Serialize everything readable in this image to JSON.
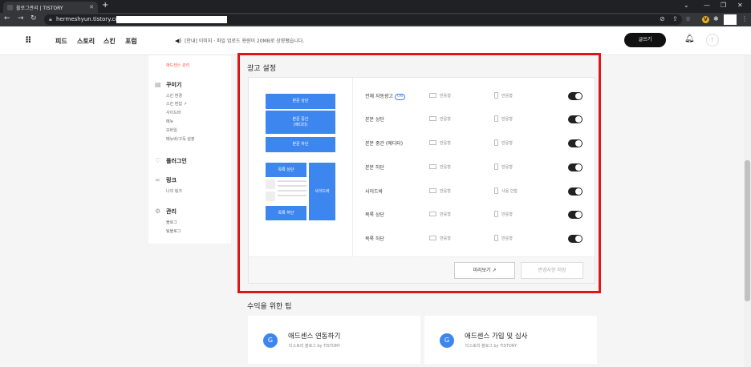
{
  "browser": {
    "tab_title": "블로그관리 | TISTORY",
    "url": "hermeshyun.tistory.com"
  },
  "header": {
    "logo": "⠿",
    "nav": [
      "피드",
      "스토리",
      "스킨",
      "포럼"
    ],
    "notice": "[안내] 이미지 · 파일 업로드 용량이 20MB로 상향됐습니다.",
    "write_button": "글쓰기",
    "avatar_initial": "T"
  },
  "sidebar": {
    "active_item": "애드센스 관리",
    "sections": [
      {
        "icon": "layout-icon",
        "title": "꾸미기",
        "items": [
          "스킨 변경",
          "스킨 편집 ↗",
          "사이드바",
          "메뉴",
          "모바일",
          "메뉴바/구독 설정"
        ]
      },
      {
        "icon": "plugin-icon",
        "title": "플러그인",
        "items": []
      },
      {
        "icon": "link-icon",
        "title": "링크",
        "items": [
          "나의 링크"
        ]
      },
      {
        "icon": "settings-icon",
        "title": "관리",
        "items": [
          "블로그",
          "팀블로그"
        ]
      }
    ]
  },
  "ad_settings": {
    "title": "광고 설정",
    "preview": {
      "body_top": "본문 상단",
      "body_middle_line1": "본문 중간",
      "body_middle_line2": "(에디터)",
      "body_bottom": "본문 하단",
      "list_top": "목록 상단",
      "list_bottom": "목록 하단",
      "sidebar": "사이드바"
    },
    "rows": [
      {
        "label": "전체 자동광고",
        "badge": "ON",
        "pc": "반응형",
        "mobile": "반응형",
        "enabled": true
      },
      {
        "label": "본문 상단",
        "pc": "반응형",
        "mobile": "반응형",
        "enabled": true
      },
      {
        "label": "본문 중간 (에디터)",
        "pc": "반응형",
        "mobile": "반응형",
        "enabled": true
      },
      {
        "label": "본문 하단",
        "pc": "반응형",
        "mobile": "반응형",
        "enabled": true
      },
      {
        "label": "사이드바",
        "pc": "반응형",
        "mobile": "사용 안함",
        "enabled": true
      },
      {
        "label": "목록 상단",
        "pc": "반응형",
        "mobile": "반응형",
        "enabled": true
      },
      {
        "label": "목록 하단",
        "pc": "반응형",
        "mobile": "반응형",
        "enabled": true
      }
    ],
    "preview_button": "미리보기 ↗",
    "save_button": "변경사항 저장"
  },
  "tips": {
    "title": "수익을 위한 팁",
    "cards": [
      {
        "icon_letter": "G",
        "title": "애드센스 연동하기",
        "subtitle": "티스토리 블로그 by TISTORY"
      },
      {
        "icon_letter": "G",
        "title": "애드센스 가입 및 심사",
        "subtitle": "티스토리 블로그 by TISTORY"
      }
    ]
  },
  "colors": {
    "accent": "#3d86f0",
    "highlight": "#e0151c",
    "active_sidebar": "#ff5544",
    "toggle_on": "#222222"
  }
}
